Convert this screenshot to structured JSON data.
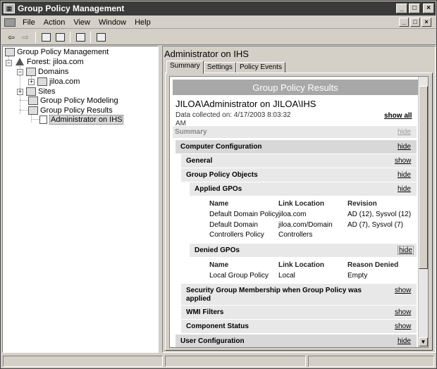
{
  "window": {
    "title": "Group Policy Management",
    "controls": [
      "_",
      "□",
      "×"
    ]
  },
  "menu": [
    "File",
    "Action",
    "View",
    "Window",
    "Help"
  ],
  "tree": {
    "root": "Group Policy Management",
    "forest": "Forest: jiloa.com",
    "domains": "Domains",
    "domain": "jiloa.com",
    "sites": "Sites",
    "modeling": "Group Policy Modeling",
    "results": "Group Policy Results",
    "selected": "Administrator on IHS"
  },
  "pane": {
    "title": "Administrator on IHS",
    "tabs": [
      "Summary",
      "Settings",
      "Policy Events"
    ]
  },
  "report": {
    "header": "Group Policy Results",
    "heading": "JILOA\\Administrator on JILOA\\IHS",
    "collected": "Data collected on: 4/17/2003 8:03:32 AM",
    "show_all": "show all",
    "summary": "Summary",
    "hide": "hide",
    "show": "show",
    "computer_config": "Computer Configuration",
    "general": "General",
    "gpo": "Group Policy Objects",
    "applied": "Applied GPOs",
    "applied_cols": [
      "Name",
      "Link Location",
      "Revision"
    ],
    "applied_rows": [
      [
        "Default Domain Policy",
        "jiloa.com",
        "AD (12), Sysvol (12)"
      ],
      [
        "Default Domain",
        "jiloa.com/Domain",
        "AD (7), Sysvol (7)"
      ],
      [
        "Controllers Policy",
        "Controllers",
        ""
      ]
    ],
    "denied": "Denied GPOs",
    "denied_cols": [
      "Name",
      "Link Location",
      "Reason Denied"
    ],
    "denied_rows": [
      [
        "Local Group Policy",
        "Local",
        "Empty"
      ]
    ],
    "security": "Security Group Membership when Group Policy was",
    "security2": "applied",
    "wmi": "WMI Filters",
    "component": "Component Status",
    "user_config": "User Configuration"
  }
}
